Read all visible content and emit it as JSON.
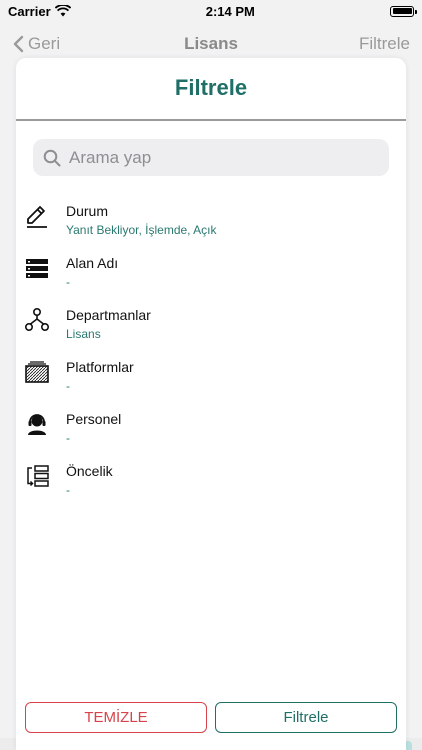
{
  "status_bar": {
    "carrier": "Carrier",
    "time": "2:14 PM"
  },
  "background_nav": {
    "back_label": "Geri",
    "title": "Lisans",
    "action": "Filtrele"
  },
  "sheet": {
    "title": "Filtrele",
    "search": {
      "placeholder": "Arama yap",
      "value": ""
    },
    "filters": [
      {
        "label": "Durum",
        "value": "Yanıt Bekliyor, İşlemde, Açık",
        "icon": "pencil-icon"
      },
      {
        "label": "Alan Adı",
        "value": "-",
        "icon": "server-icon"
      },
      {
        "label": "Departmanlar",
        "value": "Lisans",
        "icon": "hierarchy-icon"
      },
      {
        "label": "Platformlar",
        "value": "-",
        "icon": "platform-icon"
      },
      {
        "label": "Personel",
        "value": "-",
        "icon": "headset-icon"
      },
      {
        "label": "Öncelik",
        "value": "-",
        "icon": "priority-icon"
      }
    ],
    "buttons": {
      "clear": "TEMİZLE",
      "apply": "Filtrele"
    }
  },
  "colors": {
    "accent": "#1f6f66",
    "danger": "#d8424b"
  }
}
